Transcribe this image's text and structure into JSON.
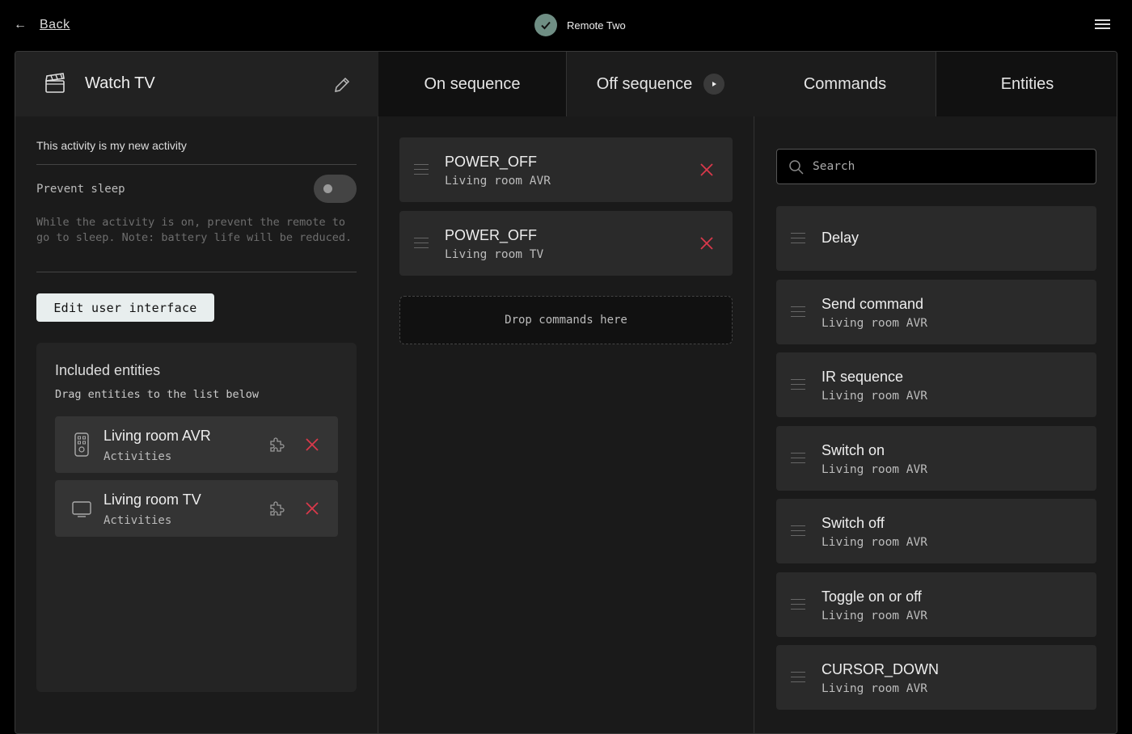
{
  "topbar": {
    "back_label": "Back",
    "device_name": "Remote Two"
  },
  "activity": {
    "title": "Watch TV",
    "description": "This activity is my new activity",
    "prevent_sleep_label": "Prevent sleep",
    "prevent_sleep_on": false,
    "prevent_sleep_help": "While the activity is on, prevent the remote to go to sleep. Note: battery life will be reduced.",
    "edit_ui_label": "Edit user interface"
  },
  "included_entities": {
    "title": "Included entities",
    "subtitle": "Drag entities to the list below",
    "items": [
      {
        "name": "Living room AVR",
        "type": "Activities",
        "icon": "remote-icon"
      },
      {
        "name": "Living room TV",
        "type": "Activities",
        "icon": "tv-icon"
      }
    ]
  },
  "sequence_tabs": {
    "on": "On sequence",
    "off": "Off sequence"
  },
  "sequence": {
    "items": [
      {
        "command": "POWER_OFF",
        "entity": "Living room AVR"
      },
      {
        "command": "POWER_OFF",
        "entity": "Living room TV"
      }
    ],
    "dropzone": "Drop commands here"
  },
  "right_tabs": {
    "commands": "Commands",
    "entities": "Entities"
  },
  "search": {
    "placeholder": "Search",
    "value": ""
  },
  "commands": [
    {
      "name": "Delay",
      "entity": ""
    },
    {
      "name": "Send command",
      "entity": "Living room AVR"
    },
    {
      "name": "IR sequence",
      "entity": "Living room AVR"
    },
    {
      "name": "Switch on",
      "entity": "Living room AVR"
    },
    {
      "name": "Switch off",
      "entity": "Living room AVR"
    },
    {
      "name": "Toggle on or off",
      "entity": "Living room AVR"
    },
    {
      "name": "CURSOR_DOWN",
      "entity": "Living room AVR"
    }
  ],
  "colors": {
    "accent_check": "#6f8e84",
    "remove_red": "#d9394b",
    "button_bg": "#e8eeee"
  }
}
